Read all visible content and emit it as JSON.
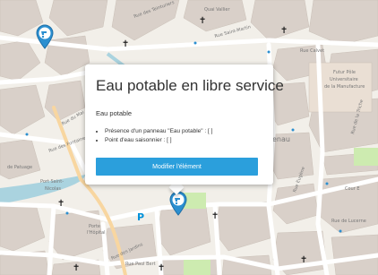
{
  "popup": {
    "title": "Eau potable en libre service",
    "subtitle": "Eau potable",
    "attributes": [
      "Présence d'un panneau \"Eau potable\" : [ ]",
      "Point d'eau saisonnier : [ ]"
    ],
    "edit_button_label": "Modifier l'élément"
  },
  "map": {
    "labels": {
      "quai_vallier": "Quai Vallier",
      "rue_calvet": "Rue Calvet",
      "rue_saint_martin": "Rue Saint-Martin",
      "rue_des_teinturiers": "Rue des Teinturiers",
      "futur_pole": "Futur Pôle",
      "universitaire": "Universitaire",
      "de_la_manufacture": "de la Manufacture",
      "rue_eugene": "Rue Eugène",
      "port_saint_nicolas_1": "Port Saint-",
      "port_saint_nicolas_2": "Nicolas",
      "rue_des_jardins": "Rue des Jardins",
      "rue_de_lucerne": "Rue de Lucerne",
      "porte_hopital_1": "Porte",
      "porte_hopital_2": "l'Hôpital",
      "rue_paul_bert": "Rue Paul Bert",
      "cour_e": "Cour E",
      "renau": "enau",
      "rue_des_fontaines": "Rue des Fontaines",
      "rue_du_mai": "Rue du Mai",
      "de_patuage": "de Patuage",
      "rue_de_la_triche": "Rue de la Triche"
    },
    "parking_label": "P",
    "markers": [
      "drinking-water-marker-north",
      "drinking-water-marker-selected"
    ],
    "colors": {
      "land": "#f2efe9",
      "building": "#d9d0c9",
      "road": "#ffffff",
      "marker": "#2b8fd0",
      "button": "#2b9fdc"
    }
  }
}
